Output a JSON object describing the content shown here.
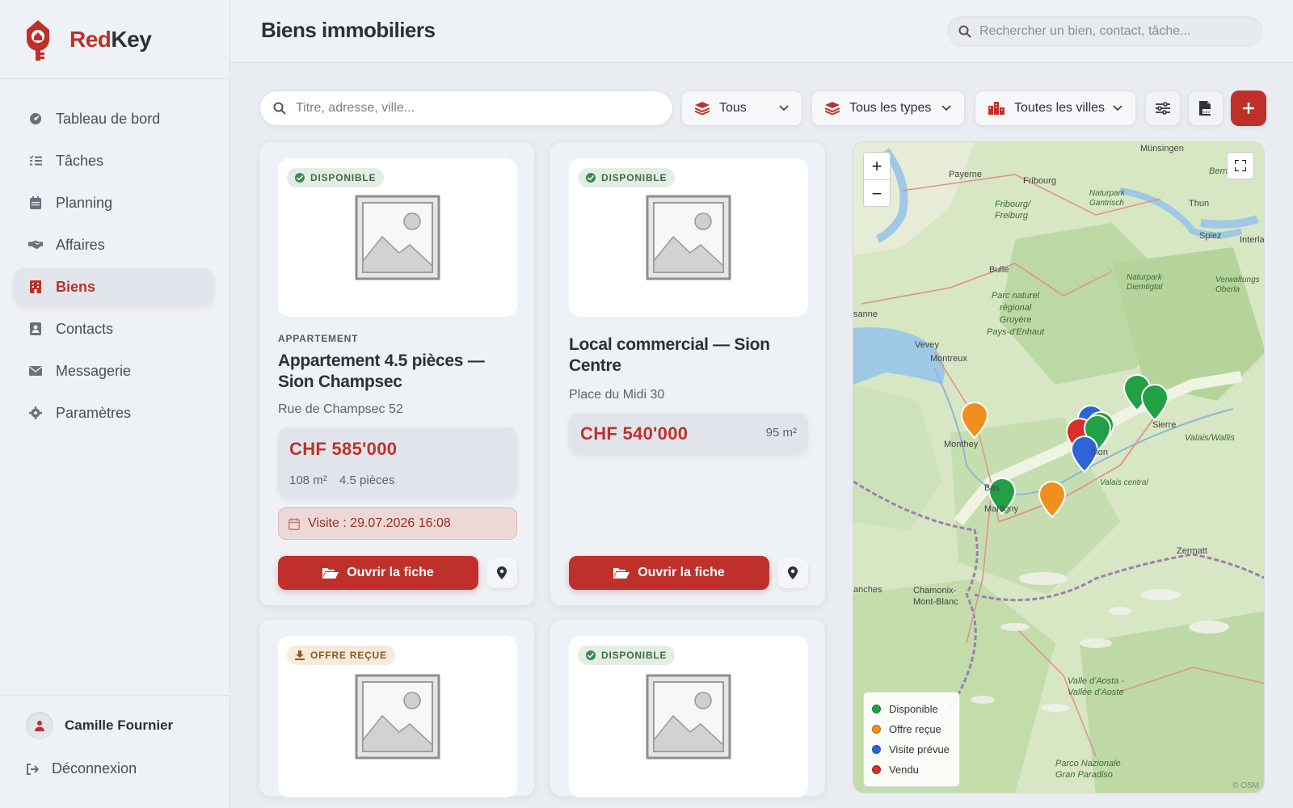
{
  "brand": {
    "part1": "Red",
    "part2": "Key"
  },
  "colors": {
    "accent": "#c0302a",
    "available": "#22a046",
    "offer": "#ef8f1f",
    "visit": "#2f64d6",
    "sold": "#d82f2a"
  },
  "sidebar": {
    "items": [
      {
        "label": "Tableau de bord",
        "icon": "dashboard-icon"
      },
      {
        "label": "Tâches",
        "icon": "tasks-icon"
      },
      {
        "label": "Planning",
        "icon": "calendar-icon"
      },
      {
        "label": "Affaires",
        "icon": "handshake-icon"
      },
      {
        "label": "Biens",
        "icon": "building-icon",
        "active": true
      },
      {
        "label": "Contacts",
        "icon": "contact-card-icon"
      },
      {
        "label": "Messagerie",
        "icon": "envelope-icon"
      },
      {
        "label": "Paramètres",
        "icon": "gear-icon"
      }
    ],
    "user_name": "Camille Fournier",
    "logout_label": "Déconnexion"
  },
  "header": {
    "title": "Biens immobiliers",
    "search_placeholder": "Rechercher un bien, contact, tâche..."
  },
  "toolbar": {
    "search_placeholder": "Titre, adresse, ville...",
    "status_filter": "Tous",
    "type_filter": "Tous les types",
    "city_filter": "Toutes les villes"
  },
  "cards": [
    {
      "status": "DISPONIBLE",
      "kind": "APPARTEMENT",
      "title": "Appartement 4.5 pièces — Sion Champsec",
      "address": "Rue de Champsec 52",
      "price": "CHF 585'000",
      "area": "108 m²",
      "rooms": "4.5 pièces",
      "visit": "Visite : 29.07.2026 16:08",
      "open_label": "Ouvrir la fiche"
    },
    {
      "status": "DISPONIBLE",
      "title": "Local commercial — Sion Centre",
      "address": "Place du Midi 30",
      "price": "CHF 540'000",
      "area": "95 m²",
      "open_label": "Ouvrir la fiche"
    },
    {
      "status": "OFFRE REÇUE"
    },
    {
      "status": "DISPONIBLE"
    }
  ],
  "map": {
    "labels": {
      "munsingen": "Münsingen",
      "bern": "Bern/Berne",
      "payerne": "Payerne",
      "fribourg": "Fribourg",
      "fribourg2": "Fribourg/\nFreiburg",
      "gantrisch": "Naturpark\nGantrisch",
      "thun": "Thun",
      "spiez": "Spiez",
      "bulle": "Bulle",
      "gruyere": "Parc naturel\nrégional\nGruyère\nPays-d'Enhaut",
      "diemtigtal": "Naturpark\nDiemtigtal",
      "lausanne": "sanne",
      "vevey": "Vevey",
      "montreux": "Montreux",
      "monthey": "Monthey",
      "sion": "Sion",
      "sierre": "Sierre",
      "valais": "Valais/Wallis",
      "valais_central": "Valais central",
      "martigny": "Martigny",
      "zermatt": "Zermatt",
      "chamonix": "Chamonix-\nMont-Blanc",
      "aosta": "Valle d'Aosta -\nVallée d'Aoste",
      "gran_paradiso": "Parco Nazionale\nGran Paradiso",
      "interlaken": "Interla",
      "verwaltung": "Verwaltungs\nOberla",
      "bas": "Bas",
      "anches": "anches"
    },
    "legend": [
      "Disponible",
      "Offre reçue",
      "Visite prévue",
      "Vendu"
    ],
    "attribution": "© OSM",
    "zoom_in": "+",
    "zoom_out": "−"
  }
}
